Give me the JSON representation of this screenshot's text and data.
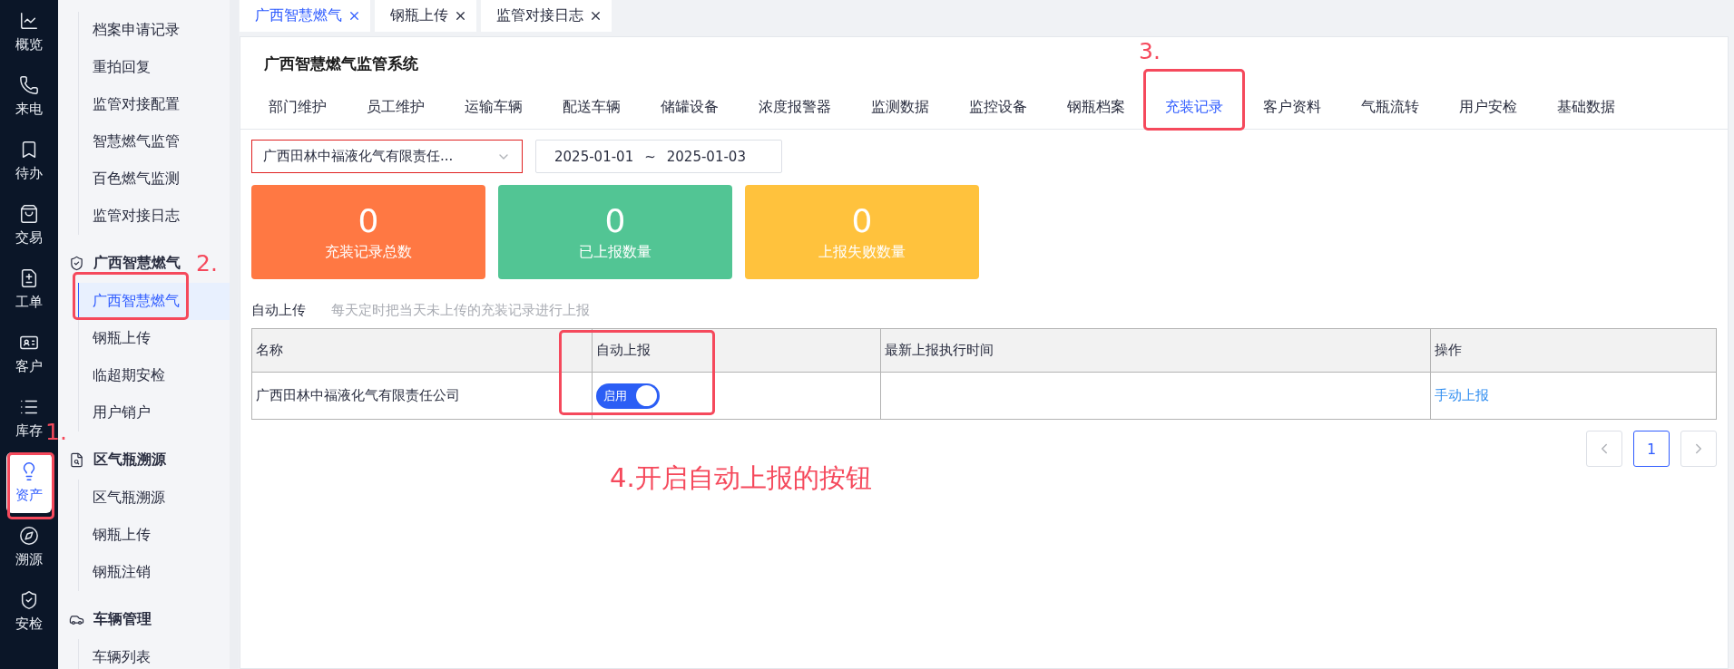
{
  "rail": [
    {
      "label": "概览",
      "selected": false,
      "highlighted": false
    },
    {
      "label": "来电",
      "selected": false,
      "highlighted": false
    },
    {
      "label": "待办",
      "selected": false,
      "highlighted": false
    },
    {
      "label": "交易",
      "selected": false,
      "highlighted": false
    },
    {
      "label": "工单",
      "selected": false,
      "highlighted": false
    },
    {
      "label": "客户",
      "selected": false,
      "highlighted": false
    },
    {
      "label": "库存",
      "selected": false,
      "highlighted": false
    },
    {
      "label": "资产",
      "selected": true,
      "highlighted": true
    },
    {
      "label": "溯源",
      "selected": false,
      "highlighted": false
    },
    {
      "label": "安检",
      "selected": false,
      "highlighted": false
    }
  ],
  "sidebar": {
    "groups": [
      {
        "items": [
          {
            "label": "档案申请记录",
            "selected": false,
            "highlighted": false
          },
          {
            "label": "重拍回复",
            "selected": false,
            "highlighted": false
          },
          {
            "label": "监管对接配置",
            "selected": false,
            "highlighted": false
          },
          {
            "label": "智慧燃气监管",
            "selected": false,
            "highlighted": false
          },
          {
            "label": "百色燃气监测",
            "selected": false,
            "highlighted": false
          },
          {
            "label": "监管对接日志",
            "selected": false,
            "highlighted": false
          }
        ]
      },
      {
        "title": "广西智慧燃气",
        "items": [
          {
            "label": "广西智慧燃气",
            "selected": true,
            "highlighted": true
          },
          {
            "label": "钢瓶上传",
            "selected": false,
            "highlighted": false
          },
          {
            "label": "临超期安检",
            "selected": false,
            "highlighted": false
          },
          {
            "label": "用户销户",
            "selected": false,
            "highlighted": false
          }
        ]
      },
      {
        "title": "区气瓶溯源",
        "items": [
          {
            "label": "区气瓶溯源",
            "selected": false,
            "highlighted": false
          },
          {
            "label": "钢瓶上传",
            "selected": false,
            "highlighted": false
          },
          {
            "label": "钢瓶注销",
            "selected": false,
            "highlighted": false
          }
        ]
      },
      {
        "title": "车辆管理",
        "items": [
          {
            "label": "车辆列表",
            "selected": false,
            "highlighted": false
          }
        ]
      }
    ]
  },
  "tabs": [
    {
      "label": "广西智慧燃气",
      "selected": true
    },
    {
      "label": "钢瓶上传",
      "selected": false
    },
    {
      "label": "监管对接日志",
      "selected": false
    }
  ],
  "header": {
    "title": "广西智慧燃气监管系统"
  },
  "nav": [
    {
      "label": "部门维护",
      "selected": false,
      "highlighted": false
    },
    {
      "label": "员工维护",
      "selected": false,
      "highlighted": false
    },
    {
      "label": "运输车辆",
      "selected": false,
      "highlighted": false
    },
    {
      "label": "配送车辆",
      "selected": false,
      "highlighted": false
    },
    {
      "label": "储罐设备",
      "selected": false,
      "highlighted": false
    },
    {
      "label": "浓度报警器",
      "selected": false,
      "highlighted": false
    },
    {
      "label": "监测数据",
      "selected": false,
      "highlighted": false
    },
    {
      "label": "监控设备",
      "selected": false,
      "highlighted": false
    },
    {
      "label": "钢瓶档案",
      "selected": false,
      "highlighted": false
    },
    {
      "label": "充装记录",
      "selected": true,
      "highlighted": true
    },
    {
      "label": "客户资料",
      "selected": false,
      "highlighted": false
    },
    {
      "label": "气瓶流转",
      "selected": false,
      "highlighted": false
    },
    {
      "label": "用户安检",
      "selected": false,
      "highlighted": false
    },
    {
      "label": "基础数据",
      "selected": false,
      "highlighted": false
    }
  ],
  "filters": {
    "company": "广西田林中福液化气有限责任...",
    "company_outlined": true,
    "date_start": "2025-01-01",
    "date_sep": "~",
    "date_end": "2025-01-03"
  },
  "stats": [
    {
      "value": "0",
      "label": "充装记录总数",
      "color": "#ff7843"
    },
    {
      "value": "0",
      "label": "已上报数量",
      "color": "#52c594"
    },
    {
      "value": "0",
      "label": "上报失败数量",
      "color": "#ffc23d"
    }
  ],
  "auto_upload": {
    "label": "自动上传",
    "hint": "每天定时把当天未上传的充装记录进行上报"
  },
  "table": {
    "columns": [
      {
        "label": "名称",
        "highlighted": false
      },
      {
        "label": "自动上报",
        "highlighted": true
      },
      {
        "label": "最新上报执行时间",
        "highlighted": false
      },
      {
        "label": "操作",
        "highlighted": false
      }
    ],
    "rows": [
      {
        "name": "广西田林中福液化气有限责任公司",
        "switch_label": "启用",
        "on": true,
        "action": "手动上报"
      }
    ]
  },
  "pagination": {
    "pages": [
      {
        "label": "1",
        "selected": true
      }
    ]
  },
  "annotations": [
    {
      "text": "1."
    },
    {
      "text": "2."
    },
    {
      "text": "3."
    },
    {
      "text": "4.开启自动上报的按钮"
    }
  ]
}
